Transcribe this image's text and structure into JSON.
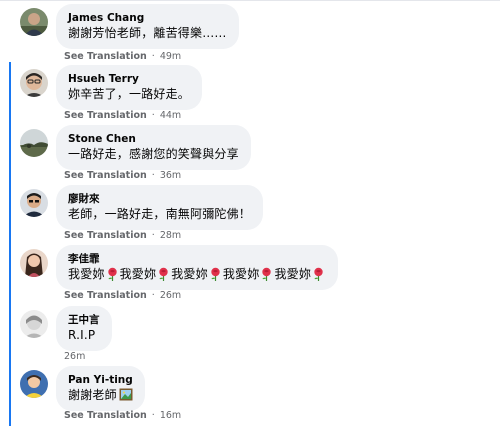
{
  "comments": [
    {
      "name": "James Chang",
      "text": "謝謝芳怡老師，離苦得樂……",
      "translate": "See Translation",
      "sep": "·",
      "time": "49m"
    },
    {
      "name": "Hsueh Terry",
      "text": "妳辛苦了，一路好走。",
      "translate": "See Translation",
      "sep": "·",
      "time": "44m"
    },
    {
      "name": "Stone Chen",
      "text": "一路好走，感謝您的笑聲與分享",
      "translate": "See Translation",
      "sep": "·",
      "time": "36m"
    },
    {
      "name": "廖財來",
      "text": "老師，一路好走，南無阿彌陀佛！",
      "translate": "See Translation",
      "sep": "·",
      "time": "28m"
    },
    {
      "name": "李佳霏",
      "text_parts": [
        "我愛妳",
        "我愛妳",
        "我愛妳",
        "我愛妳",
        "我愛妳"
      ],
      "emoji": "rose-emoji",
      "translate": "See Translation",
      "sep": "·",
      "time": "26m"
    },
    {
      "name": "王中言",
      "text": "R.I.P",
      "time": "26m"
    },
    {
      "name": "Pan Yi-ting",
      "text": "謝謝老師",
      "emoji": "framed-picture-emoji",
      "translate": "See Translation",
      "sep": "·",
      "time": "16m"
    }
  ],
  "colors": {
    "bubble": "#f0f2f5",
    "meta": "#65676b",
    "thread_line": "#1877f2"
  }
}
